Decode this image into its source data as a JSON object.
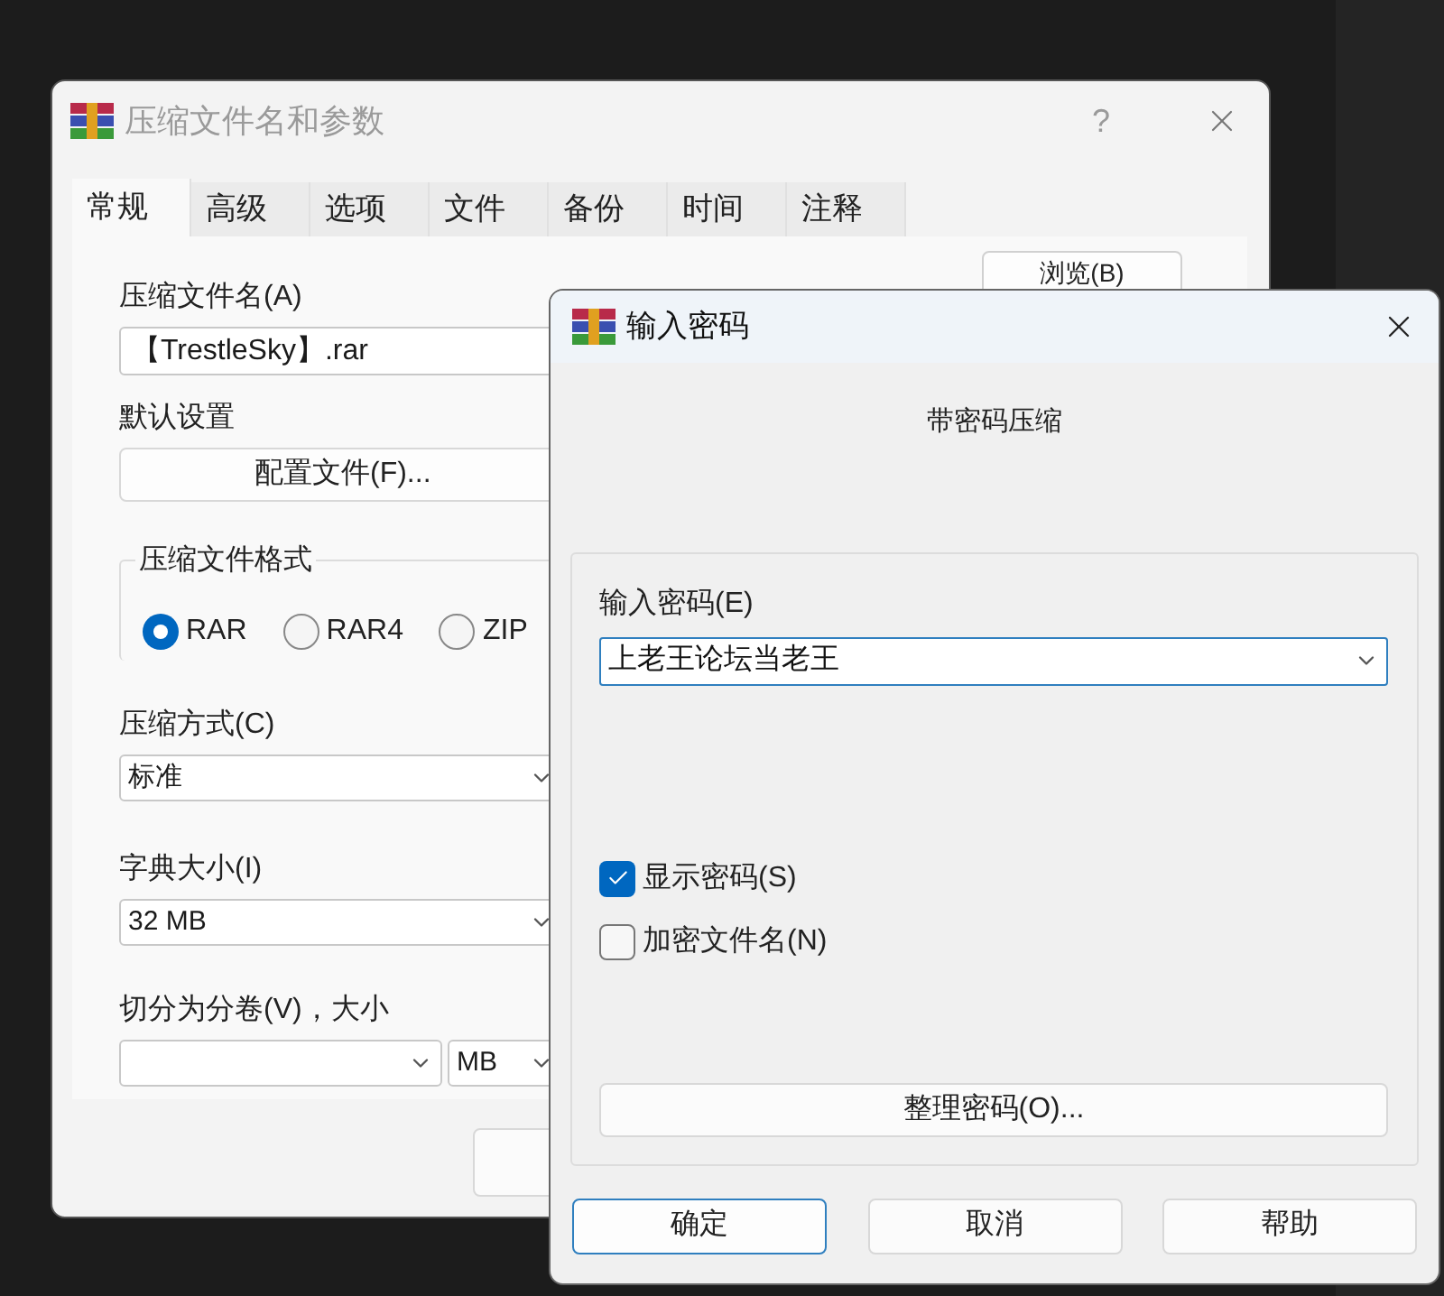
{
  "archive_window": {
    "title": "压缩文件名和参数",
    "help": "?",
    "tabs": [
      {
        "label": "常规",
        "selected": true
      },
      {
        "label": "高级",
        "selected": false
      },
      {
        "label": "选项",
        "selected": false
      },
      {
        "label": "文件",
        "selected": false
      },
      {
        "label": "备份",
        "selected": false
      },
      {
        "label": "时间",
        "selected": false
      },
      {
        "label": "注释",
        "selected": false
      }
    ],
    "archive_name": {
      "label": "压缩文件名(A)",
      "value": "【TrestleSky】.rar",
      "browse": "浏览(B)"
    },
    "default_settings": {
      "label": "默认设置",
      "button": "配置文件(F)..."
    },
    "format": {
      "title": "压缩文件格式",
      "options": [
        {
          "label": "RAR",
          "selected": true
        },
        {
          "label": "RAR4",
          "selected": false
        },
        {
          "label": "ZIP",
          "selected": false
        }
      ]
    },
    "method": {
      "label": "压缩方式(C)",
      "value": "标准"
    },
    "dictionary": {
      "label": "字典大小(I)",
      "value": "32 MB"
    },
    "split": {
      "label": "切分为分卷(V)，大小",
      "unit": "MB"
    }
  },
  "password_dialog": {
    "title": "输入密码",
    "heading": "带密码压缩",
    "password_label": "输入密码(E)",
    "password_value": "上老王论坛当老王",
    "options": [
      {
        "label": "显示密码(S)",
        "checked": true
      },
      {
        "label": "加密文件名(N)",
        "checked": false
      }
    ],
    "organize_button": "整理密码(O)...",
    "buttons": [
      {
        "label": "确定",
        "default": true
      },
      {
        "label": "取消",
        "default": false
      },
      {
        "label": "帮助",
        "default": false
      }
    ]
  }
}
